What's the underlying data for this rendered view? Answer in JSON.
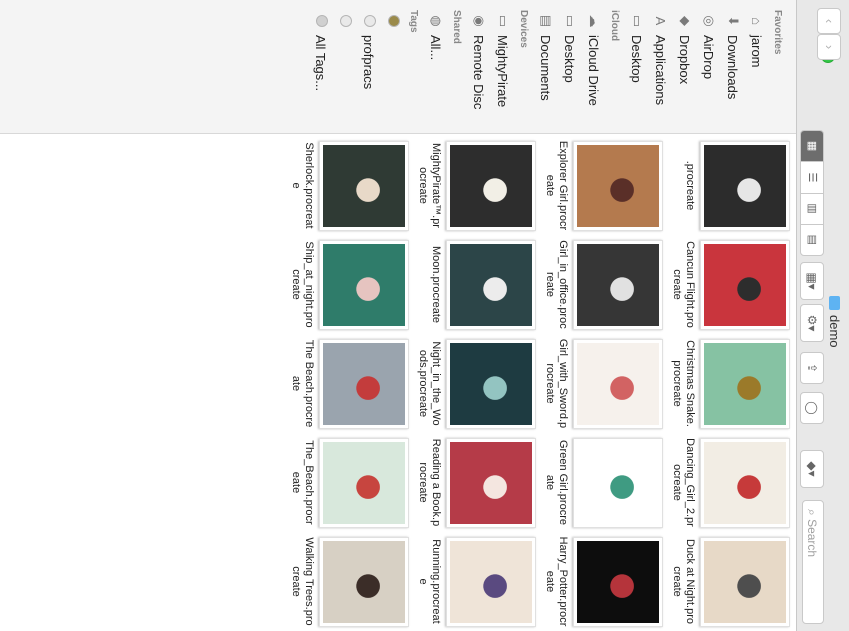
{
  "window": {
    "title": "demo",
    "back_label": "‹",
    "forward_label": "›"
  },
  "toolbar": {
    "view_icons": [
      "▦",
      "☰",
      "▥",
      "▤"
    ],
    "arrange_label": "▦▾",
    "action_label": "⚙▾",
    "share_label": "⇪",
    "tag_label": "◯",
    "dropbox_label": "◆▾",
    "search_placeholder": "Search"
  },
  "sidebar": {
    "favorites_header": "Favorites",
    "favorites": [
      {
        "label": "jarom",
        "icon": "home-icon",
        "glyph": "⌂"
      },
      {
        "label": "Downloads",
        "icon": "downloads-icon",
        "glyph": "⬇"
      },
      {
        "label": "AirDrop",
        "icon": "airdrop-icon",
        "glyph": "◎"
      },
      {
        "label": "Dropbox",
        "icon": "dropbox-icon",
        "glyph": "◆"
      },
      {
        "label": "Applications",
        "icon": "applications-icon",
        "glyph": "A"
      },
      {
        "label": "Desktop",
        "icon": "desktop-icon",
        "glyph": "▭"
      }
    ],
    "icloud_header": "iCloud",
    "icloud": [
      {
        "label": "iCloud Drive",
        "icon": "cloud-icon",
        "glyph": "☁"
      },
      {
        "label": "Desktop",
        "icon": "desktop-icon",
        "glyph": "▭"
      },
      {
        "label": "Documents",
        "icon": "documents-icon",
        "glyph": "▤"
      }
    ],
    "devices_header": "Devices",
    "devices": [
      {
        "label": "MightyPirate",
        "icon": "computer-icon",
        "glyph": "▭"
      },
      {
        "label": "Remote Disc",
        "icon": "disc-icon",
        "glyph": "◉"
      }
    ],
    "shared_header": "Shared",
    "shared": [
      {
        "label": "All...",
        "icon": "network-icon",
        "glyph": "◍"
      }
    ],
    "tags_header": "Tags",
    "tags": [
      {
        "label": "",
        "icon": "tag-icon",
        "color": "#9a8a4a"
      },
      {
        "label": "profpracs",
        "icon": "tag-icon",
        "color": "#e9e9e9"
      },
      {
        "label": "",
        "icon": "tag-icon",
        "color": "#e9e9e9"
      },
      {
        "label": "All Tags...",
        "icon": "tag-icon",
        "color": "#d0d0d0"
      }
    ]
  },
  "files": [
    {
      "name": ".procreate",
      "bg": "#2c2c2c",
      "fg": "#e6e6e6"
    },
    {
      "name": "Cancun Flight.procreate",
      "bg": "#c9353d",
      "fg": "#2d2d2d"
    },
    {
      "name": "Christmas Snake.procreate",
      "bg": "#86c2a3",
      "fg": "#9b7a2a"
    },
    {
      "name": "Dancing_Girl_2.procreate",
      "bg": "#f2ede4",
      "fg": "#c63a3a"
    },
    {
      "name": "Duck at Night.procreate",
      "bg": "#e7d9c7",
      "fg": "#4e4e4e"
    },
    {
      "name": "Explorer Girl.procreate",
      "bg": "#b47a4e",
      "fg": "#5a2f28"
    },
    {
      "name": "Girl_in_office.procreate",
      "bg": "#363636",
      "fg": "#e1e1e1"
    },
    {
      "name": "Girl_with_Sword.procreate",
      "bg": "#f6f1ec",
      "fg": "#d26363"
    },
    {
      "name": "Green Girl.procreate",
      "bg": "#ffffff",
      "fg": "#3f9b82"
    },
    {
      "name": "Harry_Potter.procreate",
      "bg": "#0d0d0d",
      "fg": "#b5343b"
    },
    {
      "name": "MightyPirate™.procreate",
      "bg": "#2d2d2d",
      "fg": "#f2efe6"
    },
    {
      "name": "Moon.procreate",
      "bg": "#2c4548",
      "fg": "#ececec"
    },
    {
      "name": "Night_in_the_Woods.procreate",
      "bg": "#1e3b41",
      "fg": "#93c4c1"
    },
    {
      "name": "Reading a Book.procreate",
      "bg": "#b53b48",
      "fg": "#f4e6e0"
    },
    {
      "name": "Running.procreate",
      "bg": "#efe4d8",
      "fg": "#5a4a80"
    },
    {
      "name": "Sherlock.procreate",
      "bg": "#2f3a34",
      "fg": "#e8d9c8"
    },
    {
      "name": "Ship_at_night.procreate",
      "bg": "#2f7c6a",
      "fg": "#e6c4c0"
    },
    {
      "name": "The Beach.procreate",
      "bg": "#9aa4ae",
      "fg": "#c33c3c"
    },
    {
      "name": "The_Beach.procreate",
      "bg": "#d8e8dc",
      "fg": "#c7453f"
    },
    {
      "name": "Walking Trees.procreate",
      "bg": "#d7d0c4",
      "fg": "#3b2d28"
    }
  ]
}
